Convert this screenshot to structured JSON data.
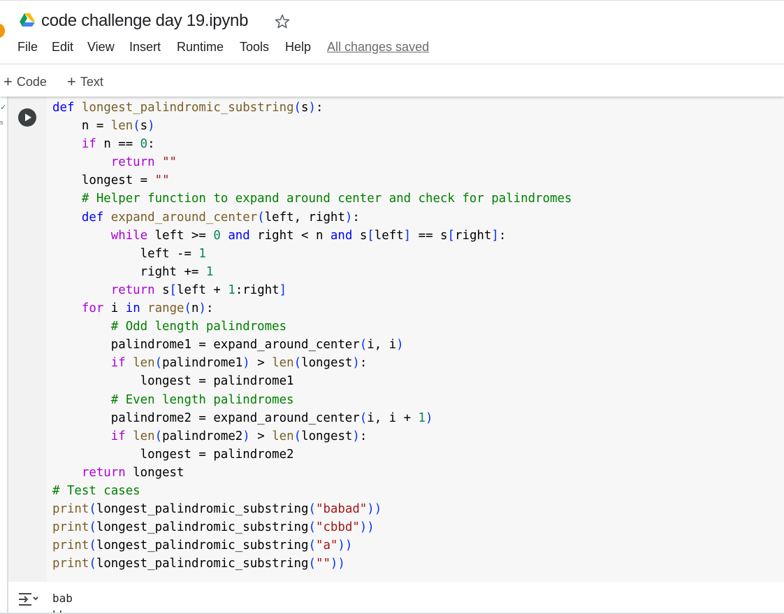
{
  "header": {
    "title": "code challenge day 19.ipynb",
    "menu": [
      "File",
      "Edit",
      "View",
      "Insert",
      "Runtime",
      "Tools",
      "Help"
    ],
    "save_status": "All changes saved"
  },
  "toolbar": {
    "add_code_label": "Code",
    "add_text_label": "Text"
  },
  "cell": {
    "status": "✓",
    "exec_time": "s",
    "code_lines": [
      "def longest_palindromic_substring(s):",
      "    n = len(s)",
      "    if n == 0:",
      "        return \"\"",
      "    longest = \"\"",
      "    # Helper function to expand around center and check for palindromes",
      "    def expand_around_center(left, right):",
      "        while left >= 0 and right < n and s[left] == s[right]:",
      "            left -= 1",
      "            right += 1",
      "        return s[left + 1:right]",
      "    for i in range(n):",
      "        # Odd length palindromes",
      "        palindrome1 = expand_around_center(i, i)",
      "        if len(palindrome1) > len(longest):",
      "            longest = palindrome1",
      "        # Even length palindromes",
      "        palindrome2 = expand_around_center(i, i + 1)",
      "        if len(palindrome2) > len(longest):",
      "            longest = palindrome2",
      "    return longest",
      "# Test cases",
      "print(longest_palindromic_substring(\"babad\"))",
      "print(longest_palindromic_substring(\"cbbd\"))",
      "print(longest_palindromic_substring(\"a\"))",
      "print(longest_palindromic_substring(\"\"))"
    ],
    "output_lines": [
      "bab",
      "bb"
    ]
  },
  "colors": {
    "keyword": "#0000ff",
    "control": "#af00db",
    "function": "#795e26",
    "number": "#098658",
    "string": "#a31515",
    "comment": "#008000",
    "cell_background": "#f7f7f7",
    "gutter_background": "#f2f2f2"
  },
  "icons": {
    "drive": "google-drive-icon",
    "star": "star-outline-icon",
    "run": "play-circle-icon",
    "output": "output-expand-icon"
  }
}
